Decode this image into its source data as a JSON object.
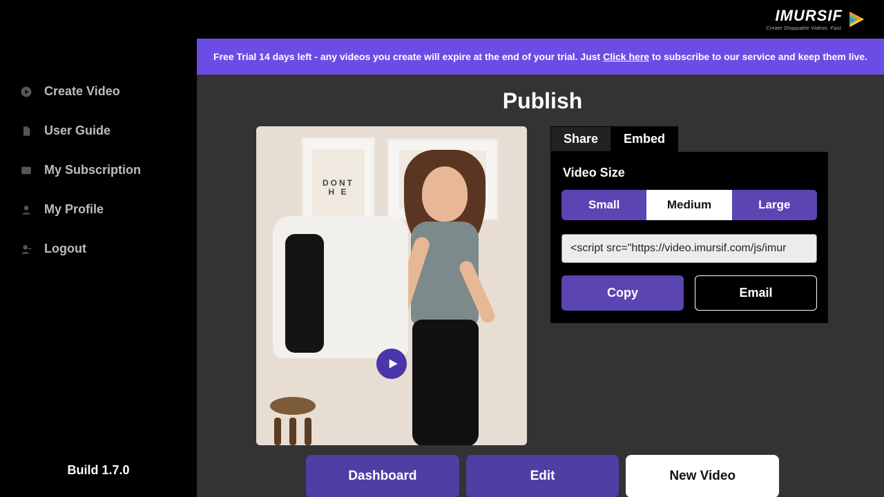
{
  "brand": {
    "name": "IMURSIF",
    "tagline": "Create Shoppable Videos. Fast."
  },
  "sidebar": {
    "items": [
      {
        "label": "Create Video"
      },
      {
        "label": "User Guide"
      },
      {
        "label": "My Subscription"
      },
      {
        "label": "My Profile"
      },
      {
        "label": "Logout"
      }
    ],
    "build": "Build 1.7.0"
  },
  "banner": {
    "pre": "Free Trial 14 days left - any videos you create will expire at the end of your trial. Just ",
    "link": "Click here",
    "post": " to subscribe to our service and keep them live."
  },
  "page": {
    "title": "Publish"
  },
  "poster": {
    "text": "DONT\nH  E"
  },
  "tabs": {
    "share": "Share",
    "embed": "Embed"
  },
  "embed": {
    "size_label": "Video Size",
    "sizes": {
      "small": "Small",
      "medium": "Medium",
      "large": "Large"
    },
    "selected": "medium",
    "code": "<script src=\"https://video.imursif.com/js/imur",
    "copy": "Copy",
    "email": "Email"
  },
  "bottom": {
    "dashboard": "Dashboard",
    "edit": "Edit",
    "newvideo": "New Video"
  }
}
